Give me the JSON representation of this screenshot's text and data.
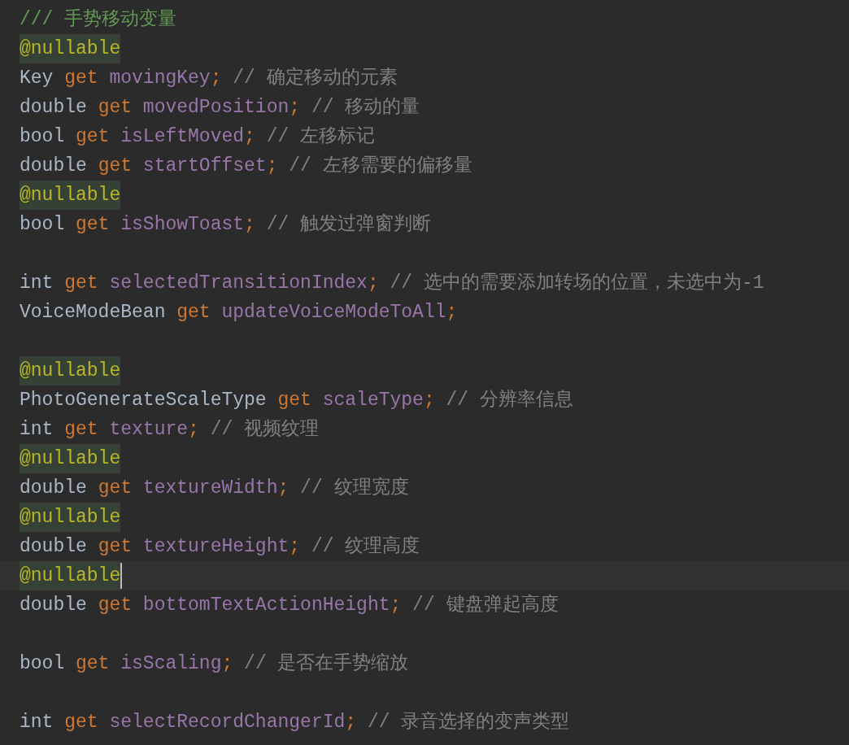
{
  "editor": {
    "blocks_above": [
      [
        {
          "tokens": [
            {
              "kind": "doc-comment",
              "text": "/// 手势移动变量"
            }
          ]
        },
        {
          "tokens": [
            {
              "kind": "annotation",
              "text": "@nullable"
            }
          ]
        },
        {
          "tokens": [
            {
              "kind": "type",
              "text": "Key"
            },
            {
              "kind": "keyword",
              "text": "get"
            },
            {
              "kind": "member",
              "text": "movingKey"
            },
            {
              "kind": "punct",
              "text": ";"
            },
            {
              "kind": "comment",
              "text": "// 确定移动的元素"
            }
          ]
        },
        {
          "tokens": [
            {
              "kind": "type",
              "text": "double"
            },
            {
              "kind": "keyword",
              "text": "get"
            },
            {
              "kind": "member",
              "text": "movedPosition"
            },
            {
              "kind": "punct",
              "text": ";"
            },
            {
              "kind": "comment",
              "text": "// 移动的量"
            }
          ]
        },
        {
          "tokens": [
            {
              "kind": "type",
              "text": "bool"
            },
            {
              "kind": "keyword",
              "text": "get"
            },
            {
              "kind": "member",
              "text": "isLeftMoved"
            },
            {
              "kind": "punct",
              "text": ";"
            },
            {
              "kind": "comment",
              "text": "// 左移标记"
            }
          ]
        },
        {
          "tokens": [
            {
              "kind": "type",
              "text": "double"
            },
            {
              "kind": "keyword",
              "text": "get"
            },
            {
              "kind": "member",
              "text": "startOffset"
            },
            {
              "kind": "punct",
              "text": ";"
            },
            {
              "kind": "comment",
              "text": "// 左移需要的偏移量"
            }
          ]
        },
        {
          "tokens": [
            {
              "kind": "annotation",
              "text": "@nullable"
            }
          ]
        },
        {
          "tokens": [
            {
              "kind": "type",
              "text": "bool"
            },
            {
              "kind": "keyword",
              "text": "get"
            },
            {
              "kind": "member",
              "text": "isShowToast"
            },
            {
              "kind": "punct",
              "text": ";"
            },
            {
              "kind": "comment",
              "text": "// 触发过弹窗判断"
            }
          ]
        }
      ],
      [
        {
          "tokens": [
            {
              "kind": "type",
              "text": "int"
            },
            {
              "kind": "keyword",
              "text": "get"
            },
            {
              "kind": "member",
              "text": "selectedTransitionIndex"
            },
            {
              "kind": "punct",
              "text": ";"
            },
            {
              "kind": "comment",
              "text": "// 选中的需要添加转场的位置，未选中为-1"
            }
          ]
        },
        {
          "tokens": [
            {
              "kind": "type",
              "text": "VoiceModeBean"
            },
            {
              "kind": "keyword",
              "text": "get"
            },
            {
              "kind": "member",
              "text": "updateVoiceModeToAll"
            },
            {
              "kind": "punct",
              "text": ";"
            }
          ]
        }
      ],
      [
        {
          "tokens": [
            {
              "kind": "annotation",
              "text": "@nullable"
            }
          ]
        },
        {
          "tokens": [
            {
              "kind": "type",
              "text": "PhotoGenerateScaleType"
            },
            {
              "kind": "keyword",
              "text": "get"
            },
            {
              "kind": "member",
              "text": "scaleType"
            },
            {
              "kind": "punct",
              "text": ";"
            },
            {
              "kind": "comment",
              "text": "// 分辨率信息"
            }
          ]
        },
        {
          "tokens": [
            {
              "kind": "type",
              "text": "int"
            },
            {
              "kind": "keyword",
              "text": "get"
            },
            {
              "kind": "member",
              "text": "texture"
            },
            {
              "kind": "punct",
              "text": ";"
            },
            {
              "kind": "comment",
              "text": "// 视频纹理"
            }
          ]
        },
        {
          "tokens": [
            {
              "kind": "annotation",
              "text": "@nullable"
            }
          ]
        },
        {
          "tokens": [
            {
              "kind": "type",
              "text": "double"
            },
            {
              "kind": "keyword",
              "text": "get"
            },
            {
              "kind": "member",
              "text": "textureWidth"
            },
            {
              "kind": "punct",
              "text": ";"
            },
            {
              "kind": "comment",
              "text": "// 纹理宽度"
            }
          ]
        },
        {
          "tokens": [
            {
              "kind": "annotation",
              "text": "@nullable"
            }
          ]
        },
        {
          "tokens": [
            {
              "kind": "type",
              "text": "double"
            },
            {
              "kind": "keyword",
              "text": "get"
            },
            {
              "kind": "member",
              "text": "textureHeight"
            },
            {
              "kind": "punct",
              "text": ";"
            },
            {
              "kind": "comment",
              "text": "// 纹理高度"
            }
          ]
        }
      ]
    ],
    "current_line": {
      "tokens": [
        {
          "kind": "annotation",
          "text": "@nullable"
        }
      ]
    },
    "blocks_below": [
      [
        {
          "tokens": [
            {
              "kind": "type",
              "text": "double"
            },
            {
              "kind": "keyword",
              "text": "get"
            },
            {
              "kind": "member",
              "text": "bottomTextActionHeight"
            },
            {
              "kind": "punct",
              "text": ";"
            },
            {
              "kind": "comment",
              "text": "// 键盘弹起高度"
            }
          ]
        }
      ],
      [
        {
          "tokens": [
            {
              "kind": "type",
              "text": "bool"
            },
            {
              "kind": "keyword",
              "text": "get"
            },
            {
              "kind": "member",
              "text": "isScaling"
            },
            {
              "kind": "punct",
              "text": ";"
            },
            {
              "kind": "comment",
              "text": "// 是否在手势缩放"
            }
          ]
        }
      ],
      [
        {
          "tokens": [
            {
              "kind": "type",
              "text": "int"
            },
            {
              "kind": "keyword",
              "text": "get"
            },
            {
              "kind": "member",
              "text": "selectRecordChangerId"
            },
            {
              "kind": "punct",
              "text": ";"
            },
            {
              "kind": "comment",
              "text": "// 录音选择的变声类型"
            }
          ]
        }
      ]
    ]
  }
}
